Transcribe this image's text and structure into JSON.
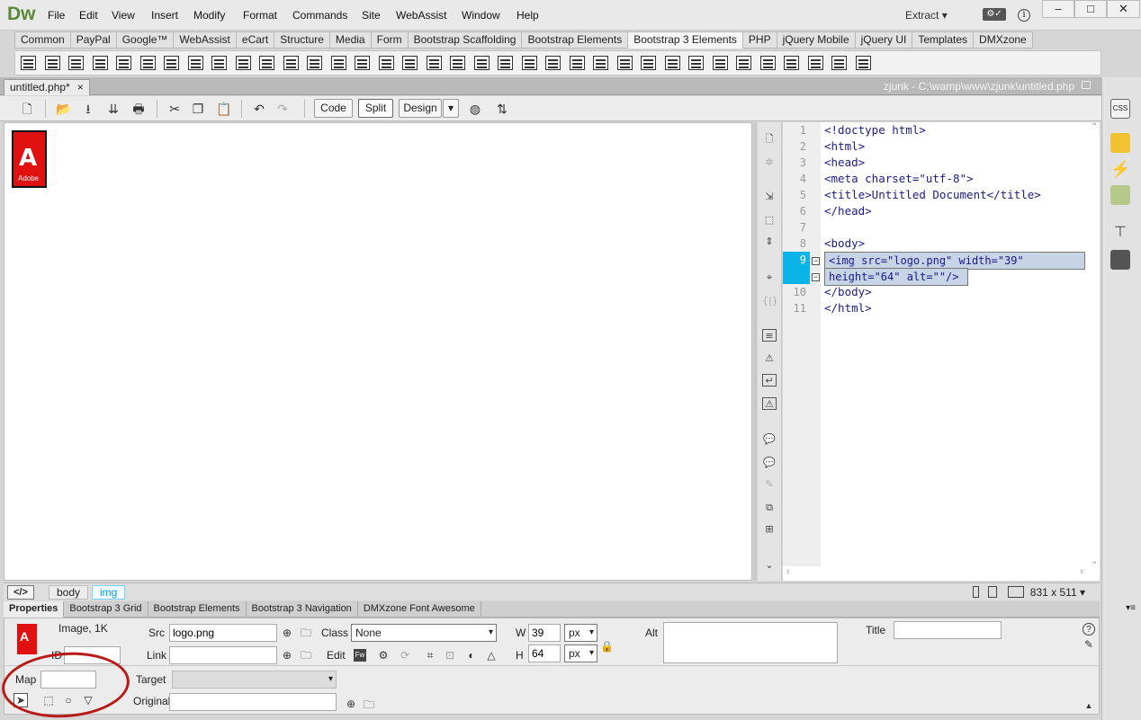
{
  "app": {
    "logo": "Dw",
    "workspace": "Extract"
  },
  "menu": [
    "File",
    "Edit",
    "View",
    "Insert",
    "Modify",
    "Format",
    "Commands",
    "Site",
    "WebAssist",
    "Window",
    "Help"
  ],
  "insert_tabs": [
    "Common",
    "PayPal",
    "Google™",
    "WebAssist",
    "eCart",
    "Structure",
    "Media",
    "Form",
    "Bootstrap Scaffolding",
    "Bootstrap Elements",
    "Bootstrap 3 Elements",
    "PHP",
    "jQuery Mobile",
    "jQuery UI",
    "Templates",
    "DMXzone"
  ],
  "active_insert_tab": "Bootstrap 3 Elements",
  "document": {
    "tab_label": "untitled.php*",
    "close": "×",
    "path": "zjunk - C:\\wamp\\www\\zjunk\\untitled.php"
  },
  "toolbar": {
    "code": "Code",
    "split": "Split",
    "design": "Design"
  },
  "design": {
    "logo_glyph": "A",
    "logo_text": "Adobe"
  },
  "code": {
    "line_numbers": [
      "1",
      "2",
      "3",
      "4",
      "5",
      "6",
      "7",
      "8",
      "9",
      "",
      "10",
      "11"
    ],
    "lines": [
      "<!doctype html>",
      "<html>",
      "<head>",
      "<meta charset=\"utf-8\">",
      "<title>Untitled Document</title>",
      "</head>",
      "",
      "<body>",
      "<img src=\"logo.png\" width=\"39\"",
      "height=\"64\" alt=\"\"/>",
      "</body>",
      "</html>"
    ]
  },
  "status": {
    "code_tag": "</>",
    "crumbs": [
      "body",
      "img"
    ],
    "window_size": "831 x 511"
  },
  "property_tabs": [
    "Properties",
    "Bootstrap 3 Grid",
    "Bootstrap Elements",
    "Bootstrap 3 Navigation",
    "DMXzone Font Awesome"
  ],
  "properties": {
    "type": "Image, 1K",
    "id_label": "ID",
    "id_value": "",
    "src_label": "Src",
    "src_value": "logo.png",
    "link_label": "Link",
    "link_value": "",
    "class_label": "Class",
    "class_value": "None",
    "edit_label": "Edit",
    "w_label": "W",
    "w_value": "39",
    "h_label": "H",
    "h_value": "64",
    "unit": "px",
    "alt_label": "Alt",
    "title_label": "Title",
    "map_label": "Map",
    "map_value": "",
    "target_label": "Target",
    "original_label": "Original",
    "original_value": ""
  }
}
